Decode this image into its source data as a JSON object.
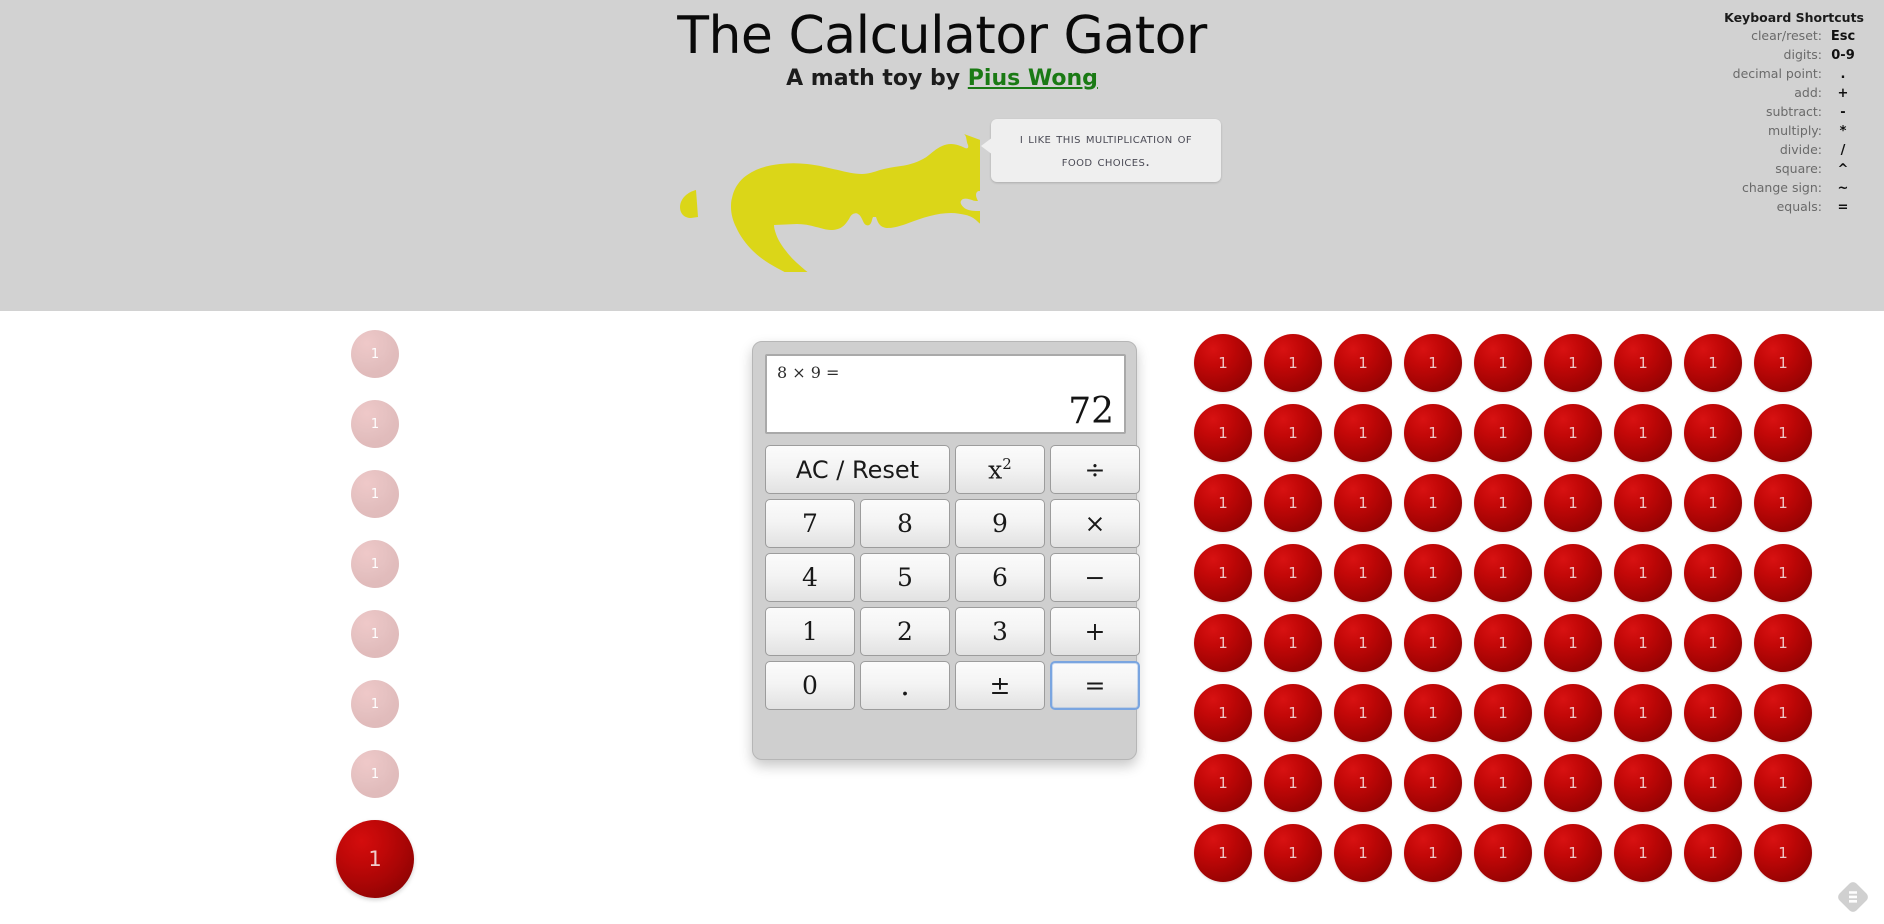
{
  "header": {
    "title": "The Calculator Gator",
    "subtitle_prefix": "A math toy by ",
    "author": "Pius Wong",
    "background_color": "#d2d2d2",
    "author_color": "#1a7a14"
  },
  "gator": {
    "name": "alligator-silhouette",
    "color": "#dbd618"
  },
  "speech_bubble": {
    "text": "I like this multiplication of food choices."
  },
  "shortcuts": {
    "title": "Keyboard Shortcuts",
    "rows": [
      {
        "label": "clear/reset:",
        "key": "Esc"
      },
      {
        "label": "digits:",
        "key": "0-9"
      },
      {
        "label": "decimal point:",
        "key": "."
      },
      {
        "label": "add:",
        "key": "+"
      },
      {
        "label": "subtract:",
        "key": "-"
      },
      {
        "label": "multiply:",
        "key": "*"
      },
      {
        "label": "divide:",
        "key": "/"
      },
      {
        "label": "square:",
        "key": "^"
      },
      {
        "label": "change sign:",
        "key": "~"
      },
      {
        "label": "equals:",
        "key": "="
      }
    ]
  },
  "calculator": {
    "display": {
      "expression": "8 × 9 =",
      "result": "72"
    },
    "keys": [
      {
        "label": "AC / Reset",
        "name": "key-ac-reset",
        "span": 2,
        "style": "ac"
      },
      {
        "label": "x²",
        "name": "key-square",
        "span": 1,
        "style": "sup"
      },
      {
        "label": "÷",
        "name": "key-divide",
        "span": 1,
        "style": ""
      },
      {
        "label": "7",
        "name": "key-7",
        "span": 1,
        "style": ""
      },
      {
        "label": "8",
        "name": "key-8",
        "span": 1,
        "style": ""
      },
      {
        "label": "9",
        "name": "key-9",
        "span": 1,
        "style": ""
      },
      {
        "label": "×",
        "name": "key-multiply",
        "span": 1,
        "style": ""
      },
      {
        "label": "4",
        "name": "key-4",
        "span": 1,
        "style": ""
      },
      {
        "label": "5",
        "name": "key-5",
        "span": 1,
        "style": ""
      },
      {
        "label": "6",
        "name": "key-6",
        "span": 1,
        "style": ""
      },
      {
        "label": "−",
        "name": "key-subtract",
        "span": 1,
        "style": ""
      },
      {
        "label": "1",
        "name": "key-1",
        "span": 1,
        "style": ""
      },
      {
        "label": "2",
        "name": "key-2",
        "span": 1,
        "style": ""
      },
      {
        "label": "3",
        "name": "key-3",
        "span": 1,
        "style": ""
      },
      {
        "label": "+",
        "name": "key-add",
        "span": 1,
        "style": ""
      },
      {
        "label": "0",
        "name": "key-0",
        "span": 1,
        "style": ""
      },
      {
        "label": ".",
        "name": "key-decimal",
        "span": 1,
        "style": "dot"
      },
      {
        "label": "±",
        "name": "key-change-sign",
        "span": 1,
        "style": ""
      },
      {
        "label": "=",
        "name": "key-equals",
        "span": 1,
        "style": "focused"
      }
    ]
  },
  "left_operand": {
    "value": 8,
    "faded_count": 7,
    "solid_count": 1,
    "ball_label": "1"
  },
  "product_grid": {
    "rows": 8,
    "columns": 9,
    "total": 72,
    "ball_label": "1"
  },
  "corner_badge": {
    "name": "feedly-badge-icon"
  }
}
